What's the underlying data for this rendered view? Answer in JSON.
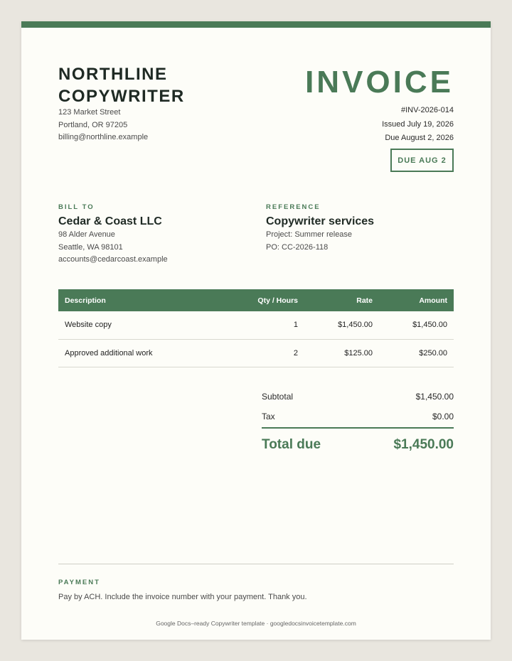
{
  "seller": {
    "name": "NORTHLINE COPYWRITER",
    "address_line1": "123 Market Street",
    "address_line2": "Portland, OR 97205",
    "email": "billing@northline.example"
  },
  "invoice": {
    "title": "INVOICE",
    "number": "#INV-2026-014",
    "issued": "Issued July 19, 2026",
    "due": "Due August 2, 2026",
    "due_badge": "DUE AUG 2"
  },
  "bill_to": {
    "label": "BILL TO",
    "name": "Cedar & Coast LLC",
    "address_line1": "98 Alder Avenue",
    "address_line2": "Seattle, WA 98101",
    "email": "accounts@cedarcoast.example"
  },
  "reference": {
    "label": "REFERENCE",
    "title": "Copywriter services",
    "project": "Project: Summer release",
    "po": "PO: CC-2026-118"
  },
  "table": {
    "headers": [
      "Description",
      "Qty / Hours",
      "Rate",
      "Amount"
    ],
    "rows": [
      [
        "Website copy",
        "1",
        "$1,450.00",
        "$1,450.00"
      ],
      [
        "Approved additional work",
        "2",
        "$125.00",
        "$250.00"
      ]
    ]
  },
  "totals": {
    "subtotal_label": "Subtotal",
    "subtotal_value": "$1,450.00",
    "tax_label": "Tax",
    "tax_value": "$0.00",
    "total_label": "Total due",
    "total_value": "$1,450.00"
  },
  "payment": {
    "label": "PAYMENT",
    "text": "Pay by ACH. Include the invoice number with your payment. Thank you."
  },
  "footer": {
    "credit": "Google Docs–ready Copywriter template · googledocsinvoicetemplate.com"
  },
  "colors": {
    "accent": "#4a7a57",
    "background": "#e9e6df",
    "paper": "#fdfdf8"
  }
}
